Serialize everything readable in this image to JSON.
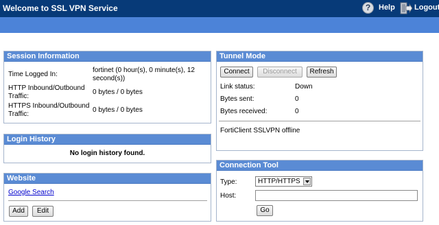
{
  "header": {
    "title": "Welcome to SSL VPN Service",
    "help_label": "Help",
    "logout_label": "Logout"
  },
  "session": {
    "title": "Session Information",
    "rows": [
      {
        "label": "Time Logged In:",
        "value": "fortinet (0 hour(s), 0 minute(s), 12 second(s))"
      },
      {
        "label": "HTTP Inbound/Outbound Traffic:",
        "value": "0 bytes / 0 bytes"
      },
      {
        "label": "HTTPS Inbound/Outbound Traffic:",
        "value": "0 bytes / 0 bytes"
      }
    ]
  },
  "login_history": {
    "title": "Login History",
    "empty_text": "No login history found."
  },
  "website": {
    "title": "Website",
    "links": [
      "Google Search"
    ],
    "add_label": "Add",
    "edit_label": "Edit"
  },
  "tunnel": {
    "title": "Tunnel Mode",
    "connect_label": "Connect",
    "disconnect_label": "Disconnect",
    "refresh_label": "Refresh",
    "stats": [
      {
        "label": "Link status:",
        "value": "Down"
      },
      {
        "label": "Bytes sent:",
        "value": "0"
      },
      {
        "label": "Bytes received:",
        "value": "0"
      }
    ],
    "client_status": "FortiClient SSLVPN offline"
  },
  "connection_tool": {
    "title": "Connection Tool",
    "type_label": "Type:",
    "type_value": "HTTP/HTTPS",
    "host_label": "Host:",
    "host_value": "",
    "go_label": "Go"
  },
  "colors": {
    "topbar": "#073a78",
    "band": "#4c83d8",
    "panel_header": "#5a8bd4",
    "link": "#0000cc"
  }
}
